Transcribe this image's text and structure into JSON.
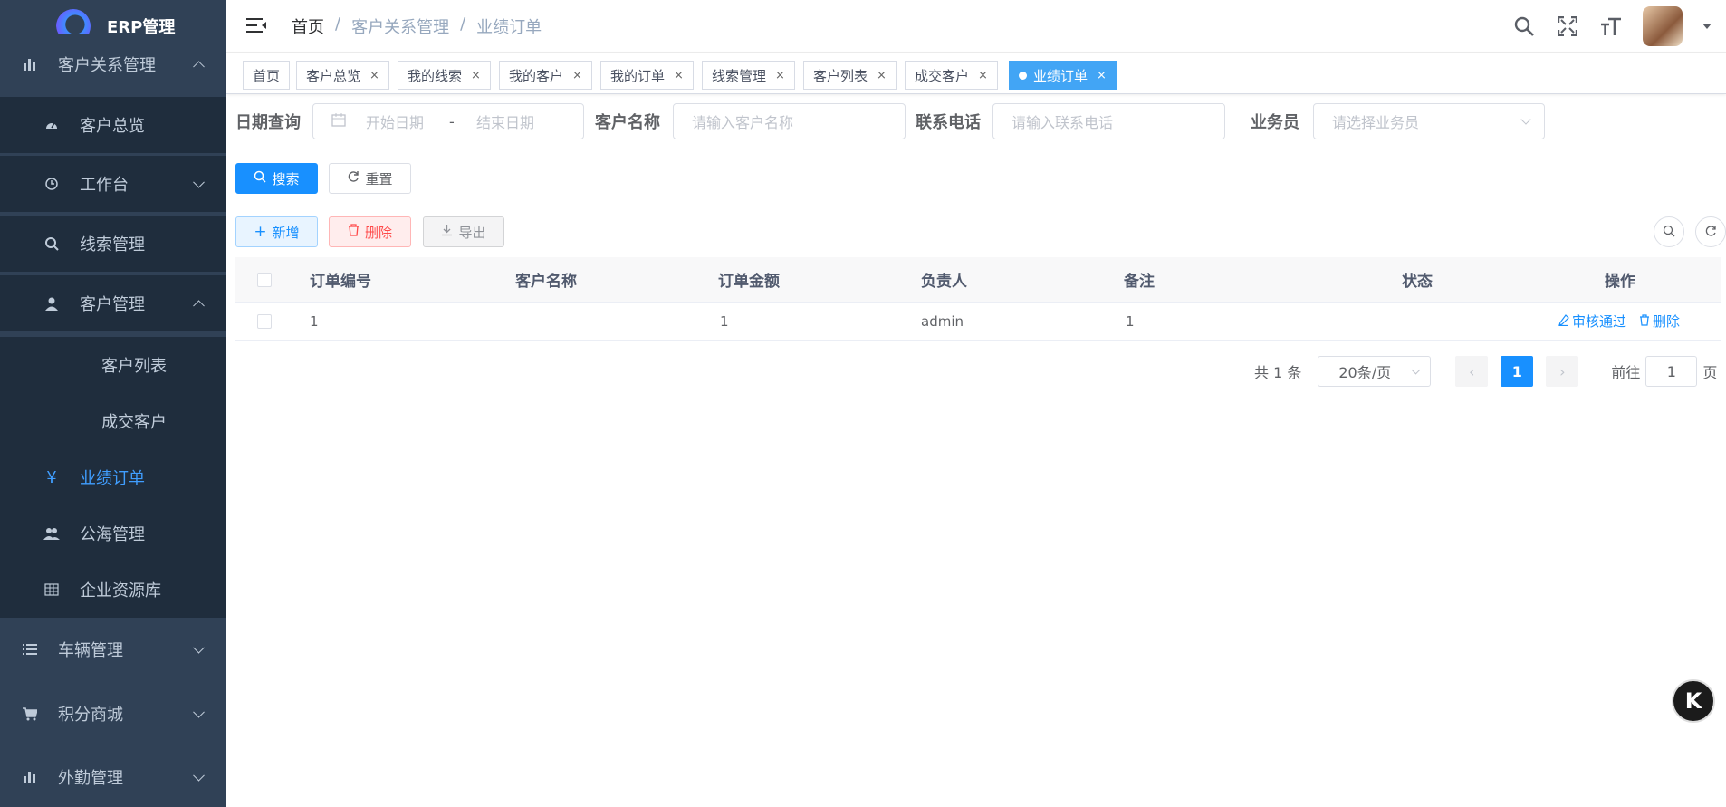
{
  "app": {
    "title": "ERP管理"
  },
  "sidebar": {
    "items": [
      {
        "label": "客户关系管理",
        "icon": "bar-chart-icon"
      },
      {
        "label": "客户总览",
        "icon": "dashboard-icon"
      },
      {
        "label": "工作台",
        "icon": "history-icon"
      },
      {
        "label": "线索管理",
        "icon": "search-icon"
      },
      {
        "label": "客户管理",
        "icon": "user-icon"
      },
      {
        "label": "客户列表"
      },
      {
        "label": "成交客户"
      },
      {
        "label": "业绩订单",
        "icon": "yen-icon"
      },
      {
        "label": "公海管理",
        "icon": "peoples-icon"
      },
      {
        "label": "企业资源库",
        "icon": "grid-icon"
      },
      {
        "label": "车辆管理",
        "icon": "list-icon"
      },
      {
        "label": "积分商城",
        "icon": "cart-icon"
      },
      {
        "label": "外勤管理",
        "icon": "bar-chart-icon"
      }
    ]
  },
  "breadcrumb": [
    "首页",
    "/",
    "客户关系管理",
    "/",
    "业绩订单"
  ],
  "tags": [
    {
      "label": "首页"
    },
    {
      "label": "客户总览",
      "close": "×"
    },
    {
      "label": "我的线索",
      "close": "×"
    },
    {
      "label": "我的客户",
      "close": "×"
    },
    {
      "label": "我的订单",
      "close": "×"
    },
    {
      "label": "线索管理",
      "close": "×"
    },
    {
      "label": "客户列表",
      "close": "×"
    },
    {
      "label": "成交客户",
      "close": "×"
    },
    {
      "label": "业绩订单",
      "close": "×"
    }
  ],
  "filters": {
    "date_label": "日期查询",
    "start_placeholder": "开始日期",
    "separator": "-",
    "end_placeholder": "结束日期",
    "customer_label": "客户名称",
    "customer_placeholder": "请输入客户名称",
    "phone_label": "联系电话",
    "phone_placeholder": "请输入联系电话",
    "salesman_label": "业务员",
    "salesman_placeholder": "请选择业务员"
  },
  "buttons": {
    "search": "搜索",
    "reset": "重置",
    "add": "新增",
    "delete": "删除",
    "export": "导出"
  },
  "table": {
    "columns": [
      "订单编号",
      "客户名称",
      "订单金额",
      "负责人",
      "备注",
      "状态",
      "操作"
    ],
    "rows": [
      {
        "order_no": "1",
        "customer": "",
        "amount": "1",
        "owner": "admin",
        "remark": "1",
        "status": "",
        "approve": "审核通过",
        "delete": "删除"
      }
    ]
  },
  "pagination": {
    "total": "共 1 条",
    "page_size": "20条/页",
    "current": "1",
    "goto_prefix": "前往",
    "goto_value": "1",
    "goto_suffix": "页"
  },
  "float_button": {
    "label": "K"
  }
}
